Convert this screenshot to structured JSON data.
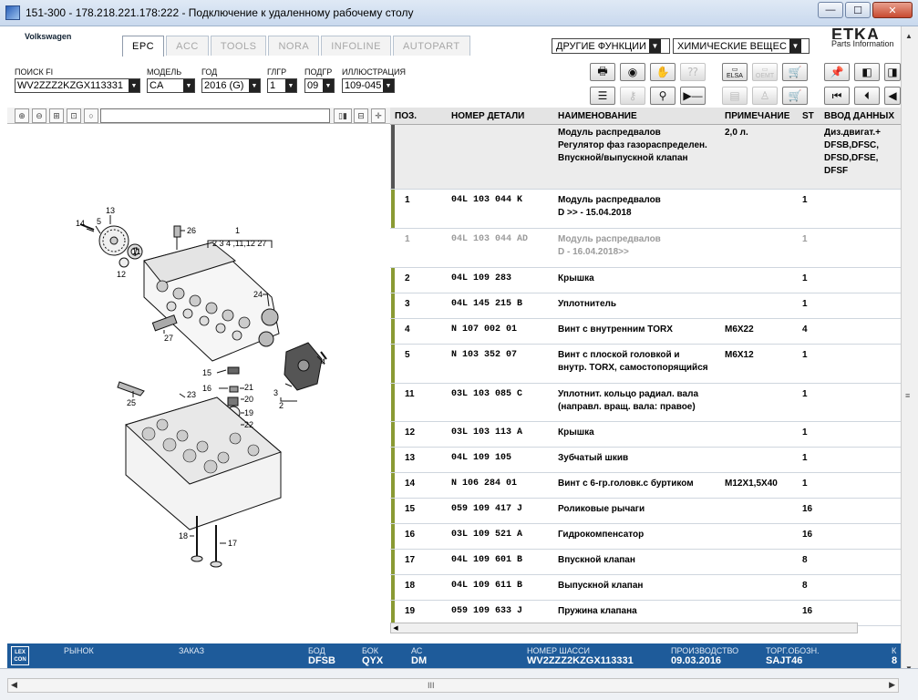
{
  "window": {
    "title": "151-300 - 178.218.221.178:222 - Подключение к удаленному рабочему столу",
    "minimize": "—",
    "maximize": "☐",
    "close": "✕"
  },
  "header": {
    "brand_logo": "Volkswagen",
    "tabs": [
      "EPC",
      "ACC",
      "TOOLS",
      "NORA",
      "INFOLINE",
      "AUTOPART"
    ],
    "active_tab": "EPC",
    "other_functions": "ДРУГИЕ ФУНКЦИИ",
    "chem_select": "ХИМИЧЕСКИЕ ВЕЩЕС",
    "etka_logo": "ETKA",
    "etka_sub": "Parts Information"
  },
  "filters": {
    "vin": {
      "label": "ПОИСК FI",
      "value": "WV2ZZZ2KZGX113331"
    },
    "model": {
      "label": "МОДЕЛЬ",
      "value": "CA"
    },
    "year": {
      "label": "ГОД",
      "value": "2016 (G)"
    },
    "group": {
      "label": "ГЛГР",
      "value": "1"
    },
    "subgroup": {
      "label": "ПОДГР",
      "value": "09"
    },
    "illustration": {
      "label": "ИЛЛЮСТРАЦИЯ",
      "value": "109-045"
    }
  },
  "toolbar": {
    "elsa_label": "ELSA",
    "oemt_label": "OEMT"
  },
  "table": {
    "headers": {
      "pos": "ПОЗ.",
      "part": "НОМЕР ДЕТАЛИ",
      "name": "НАИМЕНОВАНИЕ",
      "note": "ПРИМЕЧАНИЕ",
      "st": "ST",
      "input": "ВВОД ДАННЫХ"
    },
    "header_row": {
      "name": [
        "Модуль распредвалов",
        "Регулятор фаз газораспределен.",
        "Впускной/выпускной клапан"
      ],
      "note": "2,0 л.",
      "input": [
        "Диз.двигат.+",
        "DFSB,DFSC,",
        "DFSD,DFSE,",
        "DFSF"
      ]
    },
    "rows": [
      {
        "pos": "1",
        "part": "04L 103 044 K",
        "name": [
          "Модуль распредвалов",
          "D            >> - 15.04.2018"
        ],
        "note": "",
        "st": "1"
      },
      {
        "pos": "1",
        "part": "04L 103 044 AD",
        "name": [
          "Модуль распредвалов",
          "D - 16.04.2018>>"
        ],
        "note": "",
        "st": "1"
      },
      {
        "pos": "2",
        "part": "04L 109 283",
        "name": [
          "Крышка"
        ],
        "note": "",
        "st": "1"
      },
      {
        "pos": "3",
        "part": "04L 145 215 B",
        "name": [
          "Уплотнитель"
        ],
        "note": "",
        "st": "1"
      },
      {
        "pos": "4",
        "part": "N   107 002 01",
        "name": [
          "Винт с внутренним TORX"
        ],
        "note": "M6X22",
        "st": "4"
      },
      {
        "pos": "5",
        "part": "N   103 352 07",
        "name": [
          "Винт с плоской головкой и",
          "внутр. TORX, самостопорящийся"
        ],
        "note": "M6X12",
        "st": "1"
      },
      {
        "pos": "11",
        "part": "03L 103 085 C",
        "name": [
          "Уплотнит. кольцо радиал. вала",
          "(направл. вращ. вала: правое)"
        ],
        "note": "",
        "st": "1"
      },
      {
        "pos": "12",
        "part": "03L 103 113 A",
        "name": [
          "Крышка"
        ],
        "note": "",
        "st": "1"
      },
      {
        "pos": "13",
        "part": "04L 109 105",
        "name": [
          "Зубчатый шкив"
        ],
        "note": "",
        "st": "1"
      },
      {
        "pos": "14",
        "part": "N   106 284 01",
        "name": [
          "Винт с 6-гр.головк.с буртиком"
        ],
        "note": "M12X1,5X40",
        "st": "1"
      },
      {
        "pos": "15",
        "part": "059 109 417 J",
        "name": [
          "Роликовые рычаги"
        ],
        "note": "",
        "st": "16"
      },
      {
        "pos": "16",
        "part": "03L 109 521 A",
        "name": [
          "Гидрокомпенсатор"
        ],
        "note": "",
        "st": "16"
      },
      {
        "pos": "17",
        "part": "04L 109 601 B",
        "name": [
          "Впускной клапан"
        ],
        "note": "",
        "st": "8"
      },
      {
        "pos": "18",
        "part": "04L 109 611 B",
        "name": [
          "Выпускной клапан"
        ],
        "note": "",
        "st": "8"
      },
      {
        "pos": "19",
        "part": "059 109 633 J",
        "name": [
          "Пружина клапана"
        ],
        "note": "",
        "st": "16"
      }
    ]
  },
  "diagram": {
    "callouts": [
      "14",
      "5",
      "13",
      "11",
      "12",
      "26",
      "1",
      "2 3 4 ,11,12 27",
      "24",
      "27",
      "4",
      "3",
      "2",
      "15",
      "16",
      "21",
      "20",
      "19",
      "22",
      "25",
      "23",
      "18",
      "17"
    ]
  },
  "status": {
    "lex_logo": "LEX CON",
    "market": {
      "label": "РЫНОК",
      "value": ""
    },
    "order": {
      "label": "ЗАКАЗ",
      "value": ""
    },
    "bod": {
      "label": "БОД",
      "value": "DFSB"
    },
    "bok": {
      "label": "БОК",
      "value": "QYX"
    },
    "ac": {
      "label": "АС",
      "value": "DM"
    },
    "chassis": {
      "label": "НОМЕР ШАССИ",
      "value": "WV2ZZZ2KZGX113331"
    },
    "production": {
      "label": "ПРОИЗВОДСТВО",
      "value": "09.03.2016"
    },
    "trade": {
      "label": "ТОРГ.ОБОЗН.",
      "value": "SAJT46"
    },
    "k": {
      "label": "К",
      "value": "8"
    }
  },
  "bottom": {
    "thumb": "III"
  }
}
